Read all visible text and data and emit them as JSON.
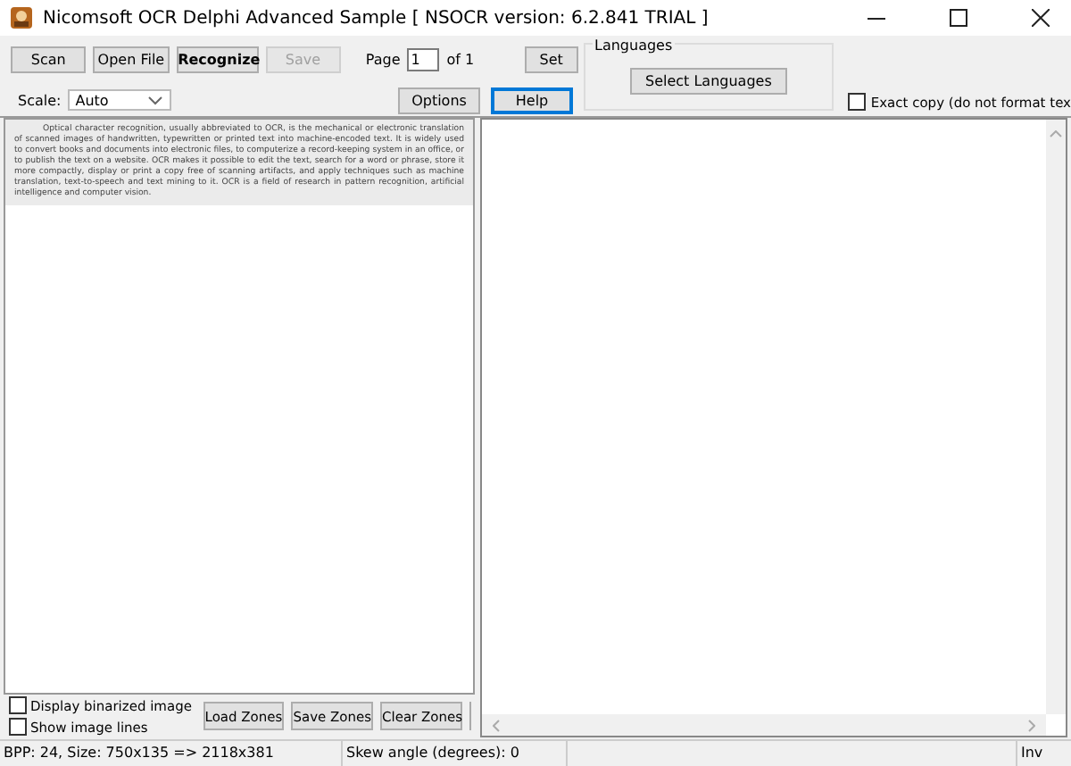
{
  "window": {
    "title": "Nicomsoft OCR Delphi Advanced Sample [ NSOCR version: 6.2.841 TRIAL ]"
  },
  "toolbar_buttons": [
    {
      "label": "Scan",
      "kind": "normal",
      "disabled": false
    },
    {
      "label": "Open File",
      "kind": "normal",
      "disabled": false
    },
    {
      "label": "Recognize",
      "kind": "default",
      "disabled": false
    },
    {
      "label": "Save",
      "kind": "normal",
      "disabled": true
    }
  ],
  "page": {
    "label": "Page",
    "value": "1",
    "of": "of 1",
    "button": "Set"
  },
  "scale": {
    "label": "Scale:",
    "value": "Auto"
  },
  "option_buttons": [
    {
      "label": "Options",
      "kind": "normal",
      "disabled": false
    },
    {
      "label": "Help",
      "kind": "focused",
      "disabled": false
    }
  ],
  "languages": {
    "title": "Languages",
    "button": "Select Languages"
  },
  "exact_copy": {
    "label": "Exact copy (do not format tex",
    "checked": false
  },
  "image_text": "Optical character recognition, usually abbreviated to OCR, is the mechanical or electronic translation of scanned images of handwritten, typewritten or printed text into machine-encoded text. It is widely used to convert books and documents into electronic files, to computerize a record-keeping system in an office, or to publish the text on a website. OCR makes it possible to edit the text, search for a word or phrase, store it more compactly, display or print a copy free of scanning artifacts, and apply techniques such as machine translation, text-to-speech and text mining to it. OCR is a field of research in pattern recognition, artificial intelligence and computer vision.",
  "bottom_checks": [
    {
      "label": "Display binarized image",
      "checked": false
    },
    {
      "label": "Show image lines",
      "checked": false
    }
  ],
  "zone_buttons": [
    "Load Zones",
    "Save Zones",
    "Clear Zones"
  ],
  "status_bar": {
    "size": "BPP: 24, Size: 750x135 => 2118x381",
    "skew": "Skew angle (degrees): 0",
    "cut_off": "Inv"
  }
}
